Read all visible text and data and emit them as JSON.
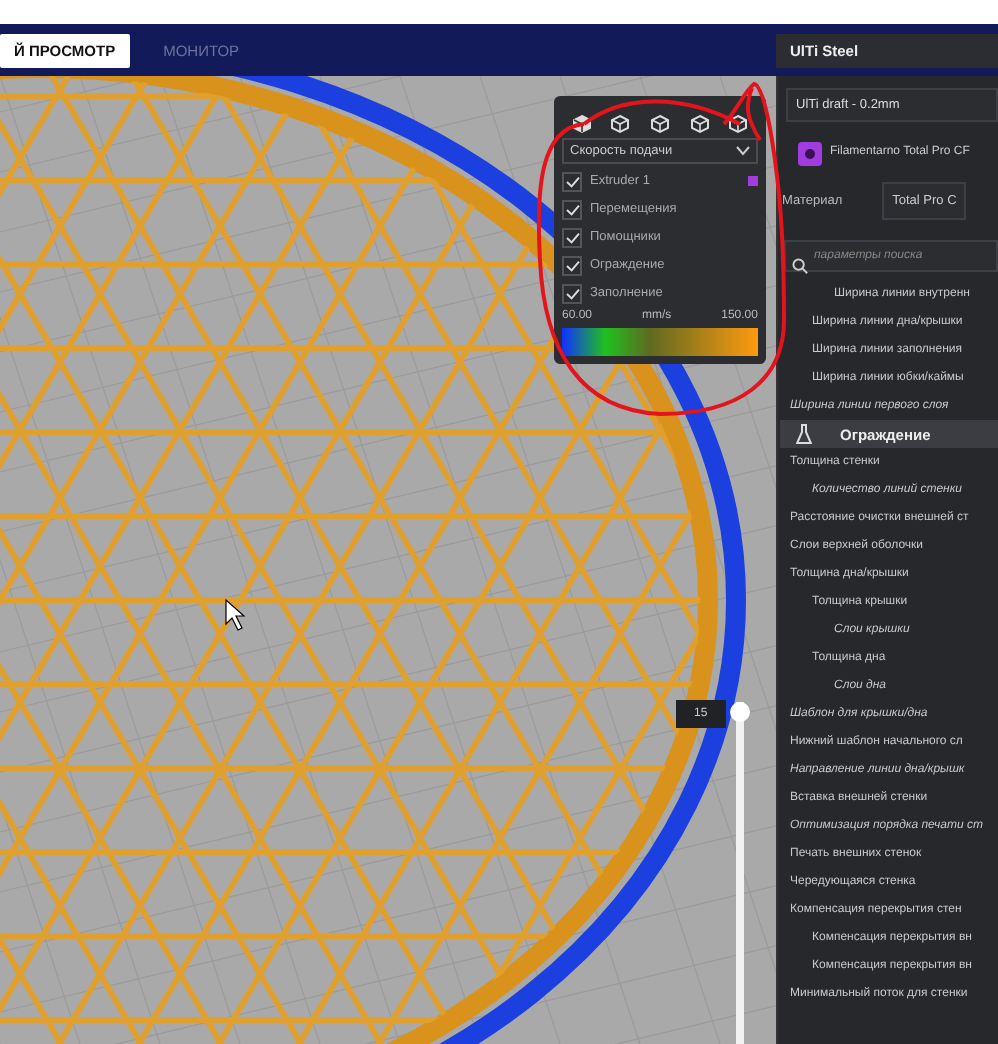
{
  "header": {
    "tabs": [
      {
        "label": "Й ПРОСМОТР",
        "selected": true
      },
      {
        "label": "МОНИТОР",
        "selected": false
      }
    ],
    "printer": "UlTi Steel"
  },
  "view_panel": {
    "color_scheme": "Скорость подачи",
    "items": [
      {
        "label": "Extruder 1",
        "checked": true,
        "color": "#a03ce0"
      },
      {
        "label": "Перемещения",
        "checked": true
      },
      {
        "label": "Помощники",
        "checked": true
      },
      {
        "label": "Ограждение",
        "checked": true
      },
      {
        "label": "Заполнение",
        "checked": true
      }
    ],
    "legend": {
      "min": "60.00",
      "unit": "mm/s",
      "max": "150.00"
    }
  },
  "layer_slider": {
    "value": "15",
    "level": 1
  },
  "settings_panel": {
    "profile": "UlTi draft - 0.2mm",
    "material_brand": "Filamentarno Total Pro CF",
    "material_label": "Материал",
    "material_value": "Total Pro C",
    "search_placeholder": "параметры поиска",
    "settings": [
      {
        "kind": "setting",
        "children": [
          {
            "kind": "setting",
            "children": [
              {
                "kind": "setting",
                "label": "Ширина линии внутренн",
                "inherited": false
              }
            ]
          },
          {
            "kind": "setting",
            "label": "Ширина линии дна/крышки",
            "inherited": false
          },
          {
            "kind": "setting",
            "label": "Ширина линии заполнения",
            "inherited": false
          },
          {
            "kind": "setting",
            "label": "Ширина линии юбки/каймы",
            "inherited": false
          }
        ]
      },
      {
        "kind": "setting",
        "label": "Ширина линии первого слоя",
        "inherited": true
      },
      {
        "kind": "category",
        "label": "Ограждение"
      },
      {
        "kind": "setting",
        "label": "Толщина стенки",
        "inherited": false,
        "children": [
          {
            "kind": "setting",
            "label": "Количество линий стенки",
            "inherited": true
          }
        ]
      },
      {
        "kind": "setting",
        "label": "Расстояние очистки внешней ст",
        "inherited": false
      },
      {
        "kind": "setting",
        "label": "Слои верхней оболочки",
        "inherited": false
      },
      {
        "kind": "setting",
        "label": "Толщина дна/крышки",
        "inherited": false,
        "children": [
          {
            "kind": "setting",
            "label": "Толщина крышки",
            "inherited": false,
            "children": [
              {
                "kind": "setting",
                "label": "Слои крышки",
                "inherited": true
              }
            ]
          },
          {
            "kind": "setting",
            "label": "Толщина дна",
            "inherited": false,
            "children": [
              {
                "kind": "setting",
                "label": "Слои дна",
                "inherited": true
              }
            ]
          }
        ]
      },
      {
        "kind": "setting",
        "label": "Шаблон для крышки/дна",
        "inherited": true
      },
      {
        "kind": "setting",
        "label": "Нижний шаблон начального сл",
        "inherited": false
      },
      {
        "kind": "setting",
        "label": "Направление линии дна/крышк",
        "inherited": true
      },
      {
        "kind": "setting",
        "label": "Вставка внешней стенки",
        "inherited": false
      },
      {
        "kind": "setting",
        "label": "Оптимизация порядка печати ст",
        "inherited": true
      },
      {
        "kind": "setting",
        "label": "Печать внешних стенок",
        "inherited": false
      },
      {
        "kind": "setting",
        "label": "Чередующаяся стенка",
        "inherited": false
      },
      {
        "kind": "setting",
        "label": "Компенсация перекрытия стен",
        "inherited": false,
        "children": [
          {
            "kind": "setting",
            "label": "Компенсация перекрытия вн",
            "inherited": false
          },
          {
            "kind": "setting",
            "label": "Компенсация перекрытия вн",
            "inherited": false
          }
        ]
      },
      {
        "kind": "setting",
        "label": "Минимальный поток для стенки",
        "inherited": false
      }
    ]
  }
}
